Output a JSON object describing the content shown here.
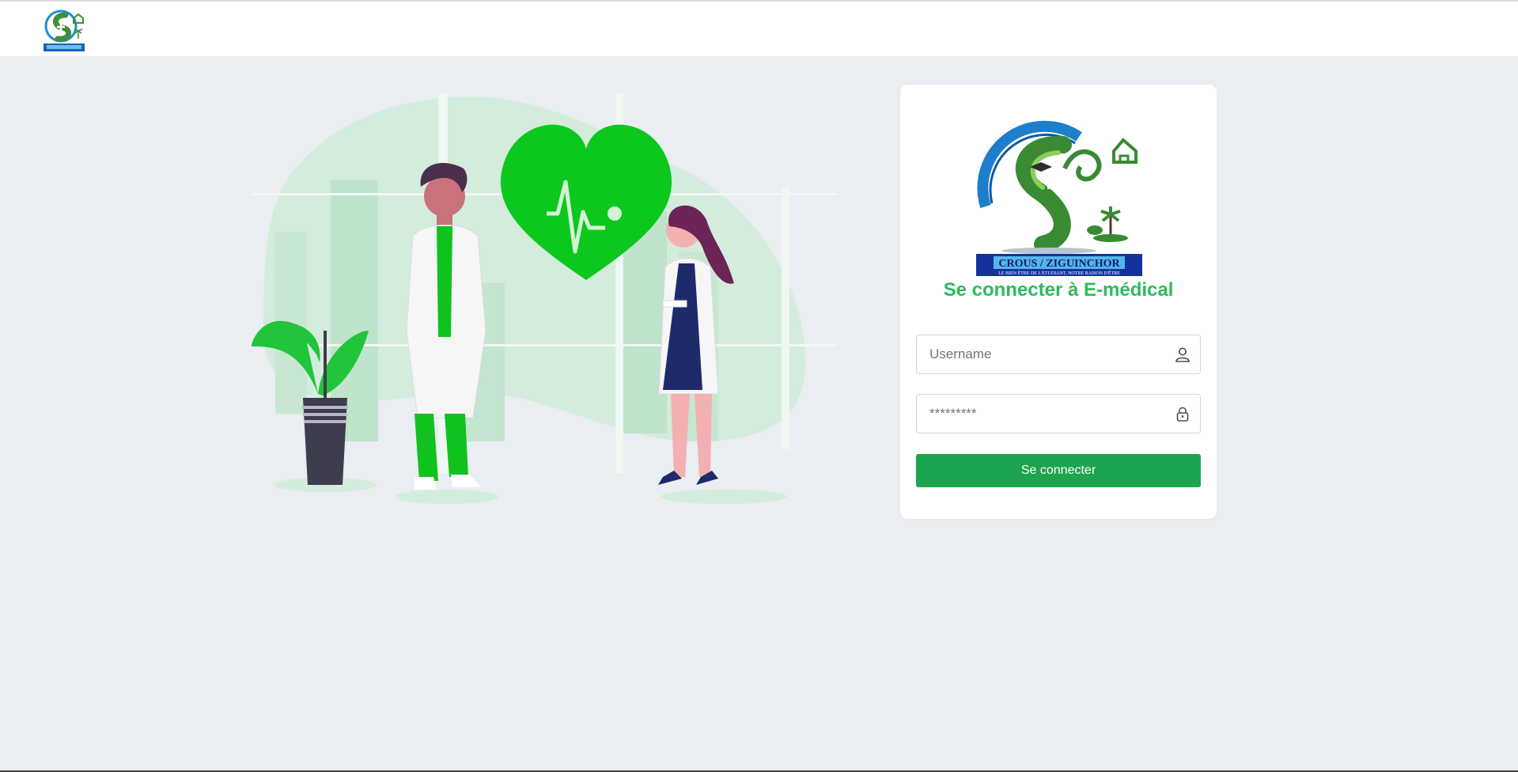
{
  "header": {
    "logo_icon": "crous-logo-icon"
  },
  "illustration": {
    "icon": "doctors-heart-illustration",
    "accent": "#0cc81d"
  },
  "login": {
    "logo_icon": "crous-ziguinchor-logo",
    "logo_banner": "CROUS / ZIGUINCHOR",
    "logo_tagline": "LE BIEN ÊTRE DE L'ÉTUDIANT, NOTRE RAISON D'ÊTRE",
    "title": "Se connecter à E-médical",
    "username": {
      "placeholder": "Username",
      "value": "",
      "icon": "user-icon"
    },
    "password": {
      "placeholder": "*********",
      "value": "",
      "icon": "lock-icon"
    },
    "submit_label": "Se connecter"
  },
  "colors": {
    "title": "#2dbb5d",
    "button": "#1ca54e",
    "background": "#eaedf2"
  }
}
